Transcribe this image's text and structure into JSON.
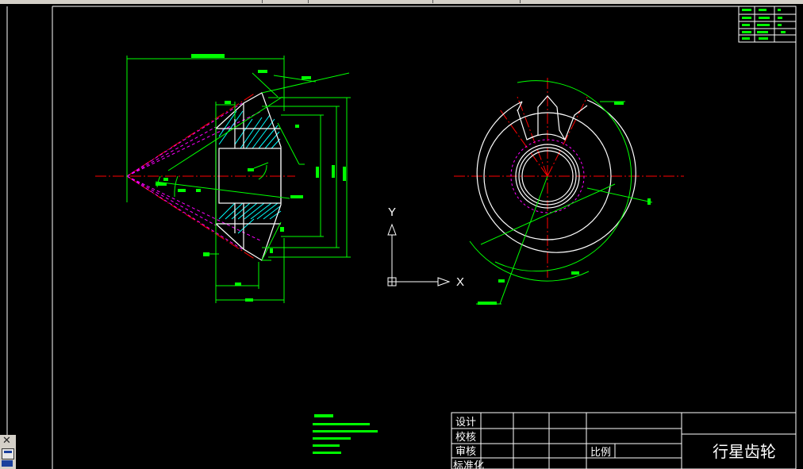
{
  "title_block": {
    "part_name": "行星齿轮",
    "scale_label": "比例",
    "rows": [
      "设计",
      "校核",
      "审核",
      "标准化"
    ]
  },
  "ucs": {
    "x_label": "X",
    "y_label": "Y"
  },
  "colors": {
    "background": "#000000",
    "outline": "#ffffff",
    "dimension": "#00ff00",
    "centerline": "#ff0000",
    "hidden": "#ff00ff",
    "hatch": "#00ffff",
    "chrome": "#d4d0c8"
  }
}
